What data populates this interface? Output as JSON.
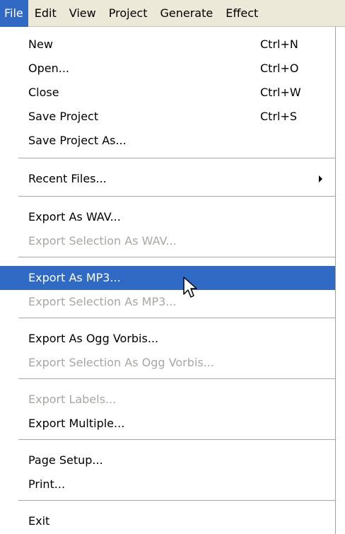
{
  "menubar": {
    "items": [
      {
        "label": "File"
      },
      {
        "label": "Edit"
      },
      {
        "label": "View"
      },
      {
        "label": "Project"
      },
      {
        "label": "Generate"
      },
      {
        "label": "Effect"
      }
    ]
  },
  "file_menu": {
    "items": [
      {
        "label": "New",
        "shortcut": "Ctrl+N"
      },
      {
        "label": "Open...",
        "shortcut": "Ctrl+O"
      },
      {
        "label": "Close",
        "shortcut": "Ctrl+W"
      },
      {
        "label": "Save Project",
        "shortcut": "Ctrl+S"
      },
      {
        "label": "Save Project As..."
      },
      {
        "label": "Recent Files..."
      },
      {
        "label": "Export As WAV..."
      },
      {
        "label": "Export Selection As WAV...",
        "disabled": true
      },
      {
        "label": "Export As MP3...",
        "highlighted": true
      },
      {
        "label": "Export Selection As MP3...",
        "disabled": true
      },
      {
        "label": "Export As Ogg Vorbis..."
      },
      {
        "label": "Export Selection As Ogg Vorbis...",
        "disabled": true
      },
      {
        "label": "Export Labels...",
        "disabled": true
      },
      {
        "label": "Export Multiple..."
      },
      {
        "label": "Page Setup..."
      },
      {
        "label": "Print..."
      },
      {
        "label": "Exit"
      }
    ]
  },
  "colors": {
    "menubar_bg": "#ece9d8",
    "highlight": "#316ac5",
    "disabled_text": "#a8a7a0"
  }
}
